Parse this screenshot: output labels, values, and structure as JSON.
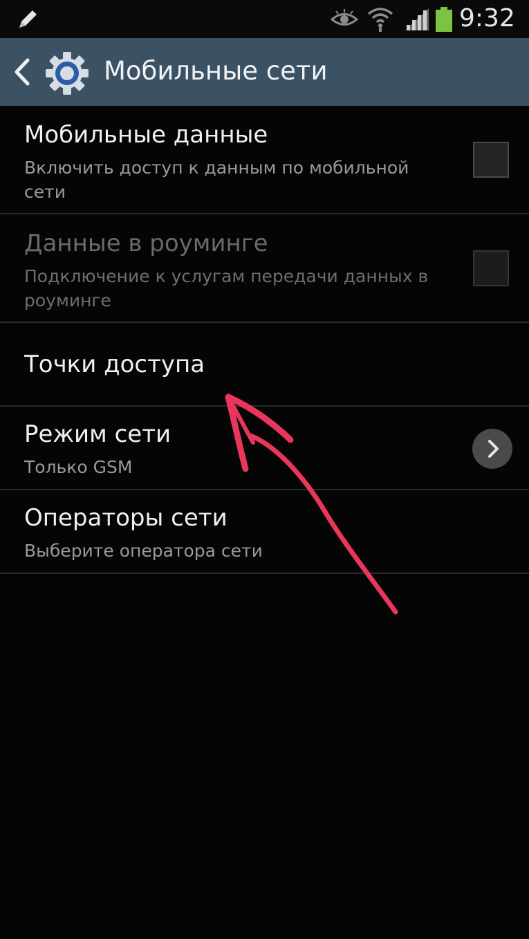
{
  "status_bar": {
    "time": "9:32",
    "icons": [
      "pencil-icon",
      "eye-icon",
      "wifi-icon",
      "signal-icon",
      "battery-icon"
    ]
  },
  "action_bar": {
    "title": "Мобильные сети",
    "back_icon": "chevron-left-icon",
    "app_icon": "gear-icon"
  },
  "settings": {
    "mobile_data": {
      "title": "Мобильные данные",
      "subtitle": "Включить доступ к данным по мобильной сети",
      "checked": false
    },
    "roaming": {
      "title": "Данные в роуминге",
      "subtitle": "Подключение к услугам передачи данных в роуминге",
      "checked": false,
      "enabled": false
    },
    "access_points": {
      "title": "Точки доступа"
    },
    "network_mode": {
      "title": "Режим сети",
      "subtitle": "Только GSM",
      "icon": "chevron-right-icon"
    },
    "network_operators": {
      "title": "Операторы сети",
      "subtitle": "Выберите оператора сети"
    }
  },
  "colors": {
    "background": "#050505",
    "action_bar": "#3b5164",
    "annotation_arrow": "#e8365d",
    "battery": "#7dc242"
  }
}
